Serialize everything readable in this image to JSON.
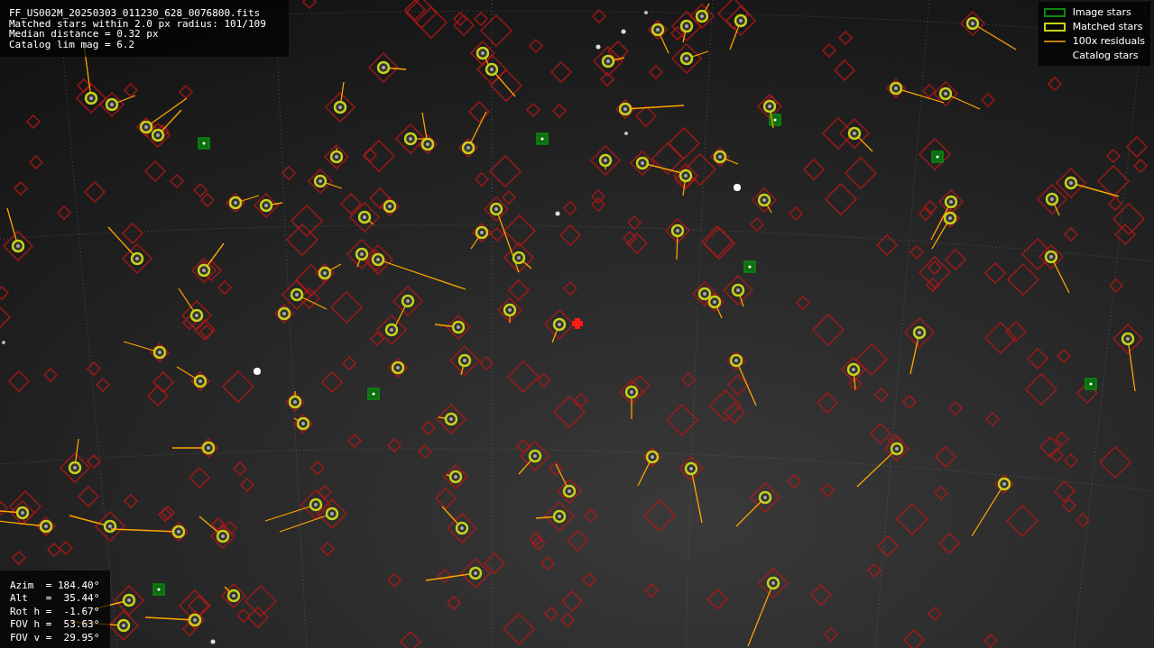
{
  "file_info": {
    "filename": "FF_US002M_20250303_011230_628_0076800.fits",
    "lines": [
      "Matched stars within 2.0 px radius: 101/109",
      "Median distance = 0.32 px",
      "Catalog lim mag = 6.2"
    ]
  },
  "legend": [
    {
      "label": "Image stars"
    },
    {
      "label": "Matched stars",
      "kind": "matched"
    },
    {
      "label": "100x residuals",
      "kind": "residual"
    },
    {
      "label": "Catalog stars",
      "kind": "catalog"
    }
  ],
  "pointing": [
    "Azim  = 184.40°",
    "Alt   =  35.44°",
    "Rot h =  -1.67°",
    "FOV h =  53.63°",
    "FOV v =  29.95°"
  ]
}
